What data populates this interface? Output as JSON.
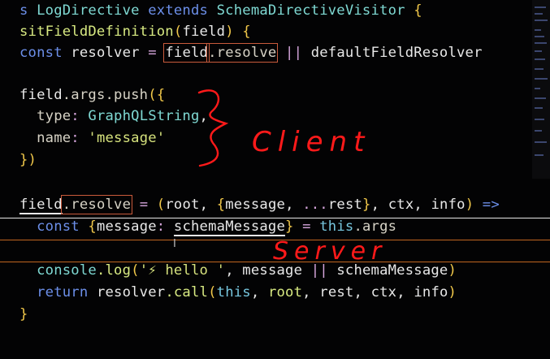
{
  "code": {
    "lines": [
      [
        {
          "t": "s ",
          "c": "tok-kw"
        },
        {
          "t": "LogDirective",
          "c": "tok-type"
        },
        {
          "t": " extends ",
          "c": "tok-kw"
        },
        {
          "t": "SchemaDirectiveVisitor",
          "c": "tok-type"
        },
        {
          "t": " {",
          "c": "tok-br"
        }
      ],
      [
        {
          "t": "sitFieldDefinition",
          "c": "tok-fn"
        },
        {
          "t": "(",
          "c": "tok-br"
        },
        {
          "t": "field",
          "c": "tok-id"
        },
        {
          "t": ")",
          "c": "tok-br"
        },
        {
          "t": " {",
          "c": "tok-br"
        }
      ],
      [
        {
          "t": "const ",
          "c": "tok-kw"
        },
        {
          "t": "resolver",
          "c": "tok-id"
        },
        {
          "t": " = ",
          "c": "tok-op"
        },
        {
          "t": "field",
          "c": "tok-id",
          "box": true
        },
        {
          "t": ".resolve",
          "c": "tok-prop",
          "box": true
        },
        {
          "t": " || ",
          "c": "tok-op"
        },
        {
          "t": "defaultFieldResolver",
          "c": "tok-id"
        }
      ],
      [],
      [
        {
          "t": "field",
          "c": "tok-id"
        },
        {
          "t": ".args.push",
          "c": "tok-prop"
        },
        {
          "t": "({",
          "c": "tok-br"
        }
      ],
      [
        {
          "t": "  type",
          "c": "tok-prop"
        },
        {
          "t": ": ",
          "c": "tok-op"
        },
        {
          "t": "GraphQLString",
          "c": "tok-type"
        },
        {
          "t": ",",
          "c": "tok-id"
        }
      ],
      [
        {
          "t": "  name",
          "c": "tok-prop"
        },
        {
          "t": ": ",
          "c": "tok-op"
        },
        {
          "t": "'message'",
          "c": "tok-str"
        }
      ],
      [
        {
          "t": "})",
          "c": "tok-br"
        }
      ],
      [],
      [
        {
          "t": "field",
          "c": "tok-id",
          "underline": true
        },
        {
          "t": ".resolve",
          "c": "tok-prop",
          "box": true
        },
        {
          "t": " = ",
          "c": "tok-op"
        },
        {
          "t": "(",
          "c": "tok-br"
        },
        {
          "t": "root",
          "c": "tok-id"
        },
        {
          "t": ", ",
          "c": "tok-id"
        },
        {
          "t": "{",
          "c": "tok-br"
        },
        {
          "t": "message",
          "c": "tok-id"
        },
        {
          "t": ", ",
          "c": "tok-id"
        },
        {
          "t": "...",
          "c": "tok-op"
        },
        {
          "t": "rest",
          "c": "tok-id"
        },
        {
          "t": "}",
          "c": "tok-br"
        },
        {
          "t": ", ",
          "c": "tok-id"
        },
        {
          "t": "ctx",
          "c": "tok-id"
        },
        {
          "t": ", ",
          "c": "tok-id"
        },
        {
          "t": "info",
          "c": "tok-id"
        },
        {
          "t": ")",
          "c": "tok-br"
        },
        {
          "t": " =>",
          "c": "tok-kw"
        }
      ],
      [
        {
          "t": "  const ",
          "c": "tok-kw"
        },
        {
          "t": "{",
          "c": "tok-br"
        },
        {
          "t": "message",
          "c": "tok-id"
        },
        {
          "t": ": ",
          "c": "tok-op"
        },
        {
          "t": "schemaMessage",
          "c": "tok-id",
          "underline": true
        },
        {
          "t": "}",
          "c": "tok-br"
        },
        {
          "t": " = ",
          "c": "tok-op"
        },
        {
          "t": "this",
          "c": "tok-this"
        },
        {
          "t": ".args",
          "c": "tok-prop"
        }
      ],
      [],
      [
        {
          "t": "  console",
          "c": "tok-type"
        },
        {
          "t": ".log",
          "c": "tok-fn"
        },
        {
          "t": "(",
          "c": "tok-br"
        },
        {
          "t": "'⚡ hello '",
          "c": "tok-str"
        },
        {
          "t": ", ",
          "c": "tok-id"
        },
        {
          "t": "message",
          "c": "tok-id"
        },
        {
          "t": " || ",
          "c": "tok-op"
        },
        {
          "t": "schemaMessage",
          "c": "tok-id"
        },
        {
          "t": ")",
          "c": "tok-br"
        }
      ],
      [
        {
          "t": "  return ",
          "c": "tok-kw"
        },
        {
          "t": "resolver",
          "c": "tok-id"
        },
        {
          "t": ".call",
          "c": "tok-fn"
        },
        {
          "t": "(",
          "c": "tok-br"
        },
        {
          "t": "this",
          "c": "tok-this"
        },
        {
          "t": ", ",
          "c": "tok-id"
        },
        {
          "t": "root",
          "c": "tok-fn"
        },
        {
          "t": ", ",
          "c": "tok-id"
        },
        {
          "t": "rest",
          "c": "tok-id"
        },
        {
          "t": ", ",
          "c": "tok-id"
        },
        {
          "t": "ctx",
          "c": "tok-id"
        },
        {
          "t": ", ",
          "c": "tok-id"
        },
        {
          "t": "info",
          "c": "tok-id"
        },
        {
          "t": ")",
          "c": "tok-br"
        }
      ],
      [
        {
          "t": "}",
          "c": "tok-br"
        }
      ]
    ]
  },
  "annotations": {
    "client_label": "Client",
    "server_label": "Server",
    "ink_color": "#ff1a1a"
  },
  "icons": {
    "text_cursor": "I"
  }
}
